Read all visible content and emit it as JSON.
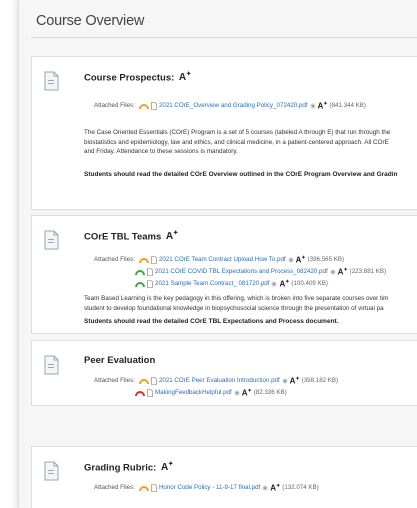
{
  "page": {
    "title": "Course Overview"
  },
  "items": [
    {
      "title": "Course Prospectus:",
      "attached_label": "Attached Files:",
      "files": [
        {
          "name": "2021 COrE_Overview and Grading Policy_072420.pdf",
          "size": "(841.344 KB)",
          "status": "orange"
        }
      ],
      "desc_1": "The Case Oriented Essentials (COrE) Program is a set of 5 courses (labeled A through E) that run through the",
      "desc_2": "biostatistics and epidemiology, law and ethics, and clinical medicine, in a patient-centered approach. All COrE",
      "desc_3": "and Friday. Attendance to these sessions is mandatory.",
      "note": "Students should read the detailed COrE Overview outlined in the COrE Program Overview and Gradin"
    },
    {
      "title": "COrE TBL Teams",
      "attached_label": "Attached Files:",
      "files": [
        {
          "name": "2021 COrE Team Contract Upload How To.pdf",
          "size": "(396.565 KB)",
          "status": "orange"
        },
        {
          "name": "2021 COrE COVID TBL Expectations and Process_082420.pdf",
          "size": "(223.881 KB)",
          "status": "green"
        },
        {
          "name": "2021 Sample Team Contract_ 081720.pdf",
          "size": "(100.409 KB)",
          "status": "green"
        }
      ],
      "desc_1": "Team Based Learning is the key pedagogy in this offering, which is broken into five separate courses over tim",
      "desc_2": "student to develop foundational knowledge in biopsychosocial science through the presentation of virtual pa",
      "note": "Students should read the detailed COrE TBL Expectations and Process document."
    },
    {
      "title": "Peer Evaluation",
      "attached_label": "Attached Files:",
      "files": [
        {
          "name": "2021 COrE Peer Evaluation Introduction.pdf",
          "size": "(398.182 KB)",
          "status": "orange"
        },
        {
          "name": "MakingFeedbackHelpful.pdf",
          "size": "(82.336 KB)",
          "status": "red"
        }
      ]
    },
    {
      "title": "Grading Rubric:",
      "attached_label": "Attached Files:",
      "files": [
        {
          "name": "Honor Code Policy - 11-9-17 final.pdf",
          "size": "(132.074 KB)",
          "status": "orange"
        }
      ]
    }
  ],
  "a11y_symbol": "A",
  "colors": {
    "orange": "#f0a020",
    "green": "#3aa84a",
    "red": "#d8322e",
    "link": "#2a6ebb"
  }
}
